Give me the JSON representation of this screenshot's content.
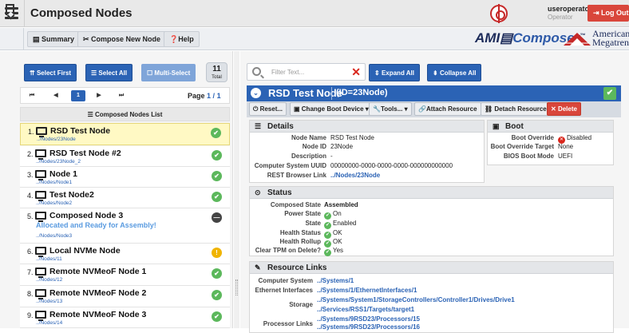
{
  "app": {
    "title": "Composed Nodes",
    "user": "useroperator",
    "role": "Operator",
    "logout": "Log Out"
  },
  "toolbar": {
    "summary": "Summary",
    "compose": "Compose New Node",
    "help": "Help",
    "brand_ami": "AMI",
    "brand_composer": "Composer",
    "brand_tm": "™",
    "brand_american": "American",
    "brand_megatrends": "Megatrends"
  },
  "list": {
    "select_first": "Select First",
    "select_all": "Select All",
    "multi_select": "Multi-Select",
    "total_count": "11",
    "total_label": "Total",
    "pager": {
      "first": "⏮",
      "prev": "◀",
      "current": "1",
      "next": "▶",
      "last": "⏭",
      "page_label": "Page",
      "page_current": "1",
      "page_sep": " / ",
      "page_total": "1"
    },
    "header": "Composed Nodes List",
    "items": [
      {
        "num": "1.",
        "name": "RSD Test Node",
        "path": "../Nodes/23Node",
        "status": "ok"
      },
      {
        "num": "2.",
        "name": "RSD Test Node #2",
        "path": "../Nodes/23Node_2",
        "status": "ok"
      },
      {
        "num": "3.",
        "name": "Node 1",
        "path": "../Nodes/Node1",
        "status": "ok"
      },
      {
        "num": "4.",
        "name": "Test Node2",
        "path": "../Nodes/Node2",
        "status": "ok"
      },
      {
        "num": "5.",
        "name": "Composed Node 3",
        "message": "Allocated and Ready for Assembly!",
        "path": "../Nodes/Node3",
        "status": "busy"
      },
      {
        "num": "6.",
        "name": "Local NVMe Node",
        "path": "../Nodes/11",
        "status": "warn"
      },
      {
        "num": "7.",
        "name": "Remote NVMeoF Node 1",
        "path": "../Nodes/12",
        "status": "ok"
      },
      {
        "num": "8.",
        "name": "Remote NVMeoF Node 2",
        "path": "../Nodes/13",
        "status": "ok"
      },
      {
        "num": "9.",
        "name": "Remote NVMeoF Node 3",
        "path": "../Nodes/14",
        "status": "ok"
      }
    ]
  },
  "detail": {
    "filter_placeholder": "Filter Text...",
    "expand_all": "Expand All",
    "collapse_all": "Collapse All",
    "node_name": "RSD Test Node",
    "node_id_label": "(ID=23Node)",
    "actions": {
      "reset": "Reset...",
      "change_boot": "Change Boot Device ▾",
      "tools": "Tools... ▾",
      "attach": "Attach Resource",
      "detach": "Detach Resource",
      "delete": "Delete"
    },
    "details": {
      "title": "Details",
      "rows": [
        {
          "k": "Node Name",
          "v": "RSD Test Node"
        },
        {
          "k": "Node ID",
          "v": "23Node"
        },
        {
          "k": "Description",
          "v": "-"
        },
        {
          "k": "Computer System UUID",
          "v": "00000000-0000-0000-0000-000000000000"
        },
        {
          "k": "REST Browser Link",
          "v": "../Nodes/23Node"
        }
      ]
    },
    "boot": {
      "title": "Boot",
      "rows": [
        {
          "k": "Boot Override",
          "v": "Disabled"
        },
        {
          "k": "Boot Override Target",
          "v": "None"
        },
        {
          "k": "BIOS Boot Mode",
          "v": "UEFI"
        }
      ]
    },
    "status": {
      "title": "Status",
      "rows": [
        {
          "k": "Composed State",
          "v": "Assembled"
        },
        {
          "k": "Power State",
          "v": "On"
        },
        {
          "k": "State",
          "v": "Enabled"
        },
        {
          "k": "Health Status",
          "v": "OK"
        },
        {
          "k": "Health Rollup",
          "v": "OK"
        },
        {
          "k": "Clear TPM on Delete?",
          "v": "Yes"
        }
      ]
    },
    "resources": {
      "title": "Resource Links",
      "computer_system_k": "Computer System",
      "computer_system_v": "../Systems/1",
      "ethernet_k": "Ethernet Interfaces",
      "ethernet_v": "../Systems/1/EthernetInterfaces/1",
      "storage_k": "Storage",
      "storage_v1": "../Systems/System1/StorageControllers/Controller1/Drives/Drive1",
      "storage_v2": "../Services/RSS1/Targets/target1",
      "processor_k": "Processor Links",
      "processor_v1": "../Systems/9RSD23/Processors/15",
      "processor_v2": "../Systems/9RSD23/Processors/16"
    }
  }
}
